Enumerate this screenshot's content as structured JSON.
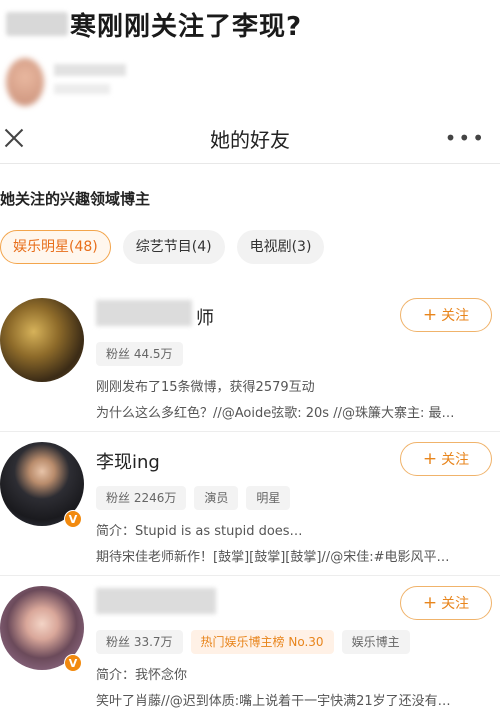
{
  "headline": {
    "text": "寒刚刚关注了李现?"
  },
  "navbar": {
    "title": "她的好友",
    "more": "•••"
  },
  "section_title": "她关注的兴趣领域博主",
  "tabs": [
    {
      "label": "娱乐明星(48)",
      "active": true
    },
    {
      "label": "综艺节目(4)",
      "active": false
    },
    {
      "label": "电视剧(3)",
      "active": false
    }
  ],
  "users": [
    {
      "name_suffix": "师",
      "follow_label": "关注",
      "tags": [
        "粉丝 44.5万"
      ],
      "line1": "刚刚发布了15条微博，获得2579互动",
      "line2": "为什么这么多红色？//@Aoide弦歌: 20s //@珠簾大寨主: 最…"
    },
    {
      "name": "李现ing",
      "follow_label": "关注",
      "verified": "V",
      "tags": [
        "粉丝 2246万",
        "演员",
        "明星"
      ],
      "line1": "简介：Stupid is as stupid does…",
      "line2": "期待宋佳老师新作！[鼓掌][鼓掌][鼓掌]//@宋佳:#电影风平…"
    },
    {
      "follow_label": "关注",
      "verified": "V",
      "tags": [
        "粉丝 33.7万",
        "热门娱乐博主榜 No.30",
        "娱乐博主"
      ],
      "line1": "简介：我怀念你",
      "line2": "笑叶了肖藤//@迟到体质:嘴上说着干一宇快满21岁了还没有…"
    }
  ],
  "colors": {
    "accent": "#e8851c",
    "verified_badge": "#f28a0f"
  }
}
